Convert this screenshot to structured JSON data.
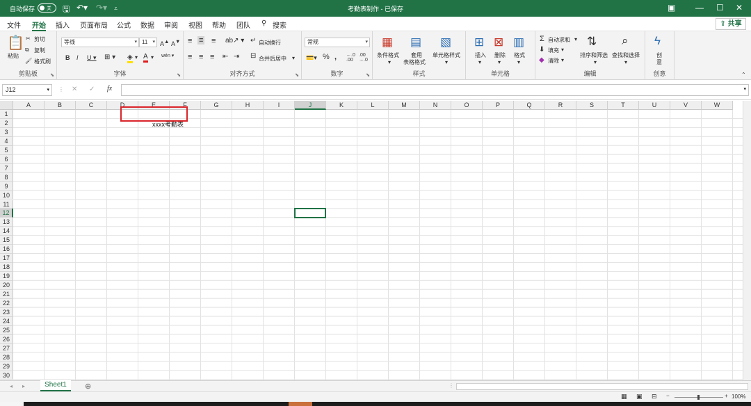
{
  "titlebar": {
    "autosave_label": "自动保存",
    "autosave_state": "关",
    "doc_title": "考勤表制作 - 已保存",
    "accent": "#217346"
  },
  "tabs": [
    {
      "label": "文件"
    },
    {
      "label": "开始"
    },
    {
      "label": "插入"
    },
    {
      "label": "页面布局"
    },
    {
      "label": "公式"
    },
    {
      "label": "数据"
    },
    {
      "label": "审阅"
    },
    {
      "label": "视图"
    },
    {
      "label": "帮助"
    },
    {
      "label": "团队"
    },
    {
      "label": "搜索"
    }
  ],
  "share_label": "共享",
  "ribbon": {
    "clipboard": {
      "label": "剪贴板",
      "paste": "粘贴",
      "cut": "剪切",
      "copy": "复制",
      "format_painter": "格式刷"
    },
    "font": {
      "label": "字体",
      "font_name": "等线",
      "font_size": "11"
    },
    "alignment": {
      "label": "对齐方式",
      "wrap_text": "自动换行",
      "merge_center": "合并后居中"
    },
    "number": {
      "label": "数字",
      "format": "常规"
    },
    "styles": {
      "label": "样式",
      "conditional": "条件格式",
      "table_style_1": "套用",
      "table_style_2": "表格格式",
      "cell_styles": "单元格样式"
    },
    "cells": {
      "label": "单元格",
      "insert": "插入",
      "delete": "删除",
      "format": "格式"
    },
    "editing": {
      "label": "编辑",
      "autosum": "自动求和",
      "fill": "填充",
      "clear": "清除",
      "sort_filter": "排序和筛选",
      "find_select": "查找和选择"
    },
    "ideas": {
      "label": "创意",
      "btn_1": "创",
      "btn_2": "意"
    }
  },
  "formula_bar": {
    "name_box": "J12",
    "fx": "fx"
  },
  "columns": [
    "A",
    "B",
    "C",
    "D",
    "E",
    "F",
    "G",
    "H",
    "I",
    "J",
    "K",
    "L",
    "M",
    "N",
    "O",
    "P",
    "Q",
    "R",
    "S",
    "T",
    "U",
    "V",
    "W"
  ],
  "rows": [
    "1",
    "2",
    "3",
    "4",
    "5",
    "6",
    "7",
    "8",
    "9",
    "10",
    "11",
    "12",
    "13",
    "14",
    "15",
    "16",
    "17",
    "18",
    "19",
    "20",
    "21",
    "22",
    "23",
    "24",
    "25",
    "26",
    "27",
    "28",
    "29",
    "30"
  ],
  "selected_col": "J",
  "selected_row": "12",
  "cell_d1": "xxxx考勤表",
  "sheet_tab": "Sheet1",
  "zoom": "100%"
}
